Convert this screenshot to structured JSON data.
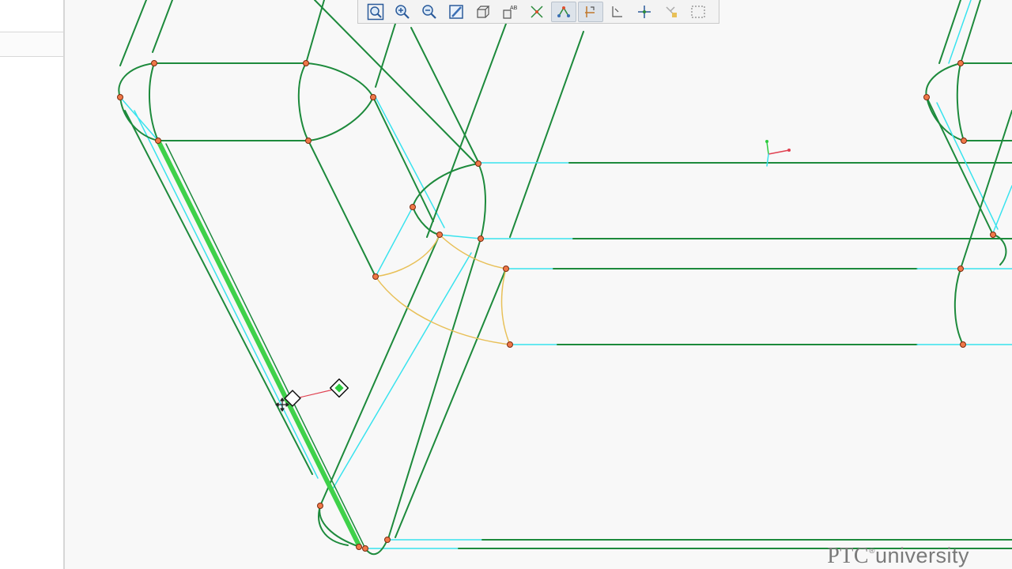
{
  "app": {
    "watermark_ptc": "PTC",
    "watermark_reg": "®",
    "watermark_rest": "university"
  },
  "toolbar": {
    "buttons": [
      {
        "id": "refit",
        "icon": "zoom-fit-icon"
      },
      {
        "id": "zoom-in",
        "icon": "zoom-in-icon"
      },
      {
        "id": "zoom-out",
        "icon": "zoom-out-icon"
      },
      {
        "id": "repaint",
        "icon": "repaint-icon"
      },
      {
        "id": "display-style",
        "icon": "display-style-icon"
      },
      {
        "id": "saved-orientations",
        "icon": "saved-views-icon"
      },
      {
        "id": "sketch-display",
        "icon": "sketch-display-icon"
      },
      {
        "id": "dimension-display",
        "icon": "dimension-display-icon"
      },
      {
        "id": "constraint-display",
        "icon": "constraint-display-icon"
      },
      {
        "id": "grid-display",
        "icon": "grid-display-icon"
      },
      {
        "id": "vertex-display",
        "icon": "vertex-display-icon"
      },
      {
        "id": "annotation-display",
        "icon": "annotation-display-icon"
      },
      {
        "id": "select-box",
        "icon": "selection-box-icon"
      }
    ],
    "active": [
      "sketch-display",
      "dimension-display"
    ]
  },
  "colors": {
    "edge_green": "#1d8a3c",
    "tangent_cyan": "#39e3ee",
    "vertex_orange": "#f07848",
    "preview_yellow": "#e8c058",
    "highlight_green": "#3fd14a",
    "dimension_red": "#e04050"
  }
}
